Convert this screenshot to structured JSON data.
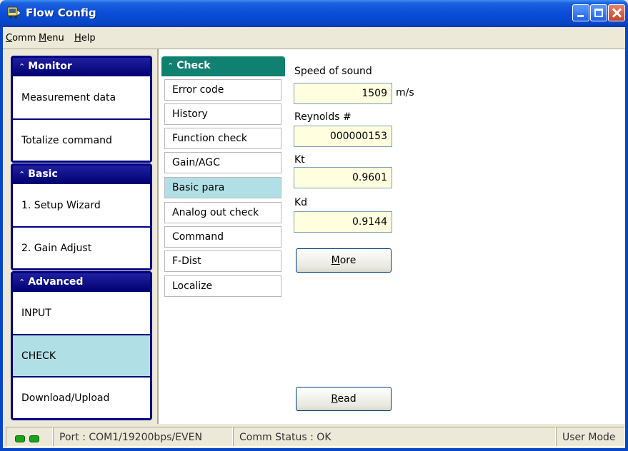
{
  "window": {
    "title": "Flow Config"
  },
  "menubar": {
    "items": [
      {
        "first": "C",
        "rest": "omm"
      },
      {
        "first": "M",
        "rest": "enu"
      },
      {
        "first": "H",
        "rest": "elp"
      }
    ]
  },
  "sidebar": {
    "groups": [
      {
        "title": "Monitor",
        "items": [
          "Measurement data",
          "Totalize command"
        ]
      },
      {
        "title": "Basic",
        "items": [
          "1. Setup Wizard",
          "2. Gain Adjust"
        ]
      },
      {
        "title": "Advanced",
        "items": [
          "INPUT",
          "CHECK",
          "Download/Upload"
        ],
        "active": "CHECK"
      }
    ]
  },
  "check_menu": {
    "title": "Check",
    "items": [
      "Error code",
      "History",
      "Function check",
      "Gain/AGC",
      "Basic para",
      "Analog out check",
      "Command",
      "F-Dist",
      "Localize"
    ],
    "active": "Basic para"
  },
  "fields": {
    "speed_of_sound": {
      "label": "Speed of sound",
      "value": "1509",
      "unit": "m/s"
    },
    "reynolds": {
      "label": "Reynolds #",
      "value": "000000153"
    },
    "kt": {
      "label": "Kt",
      "value": "0.9601"
    },
    "kd": {
      "label": "Kd",
      "value": "0.9144"
    }
  },
  "buttons": {
    "more": {
      "first": "M",
      "rest": "ore"
    },
    "read": {
      "first": "R",
      "rest": "ead"
    }
  },
  "statusbar": {
    "port": "Port : COM1/19200bps/EVEN",
    "comm_status": "Comm Status : OK",
    "mode": "User Mode"
  },
  "colors": {
    "accent_blue": "#0846c8",
    "group_navy": "#000080",
    "check_teal": "#108070",
    "active_bg": "#b0e0e6",
    "field_bg": "#ffffe0"
  },
  "icons": [
    "app-icon",
    "minimize-icon",
    "maximize-icon",
    "close-icon",
    "chevron-up-icon",
    "led-icon"
  ]
}
